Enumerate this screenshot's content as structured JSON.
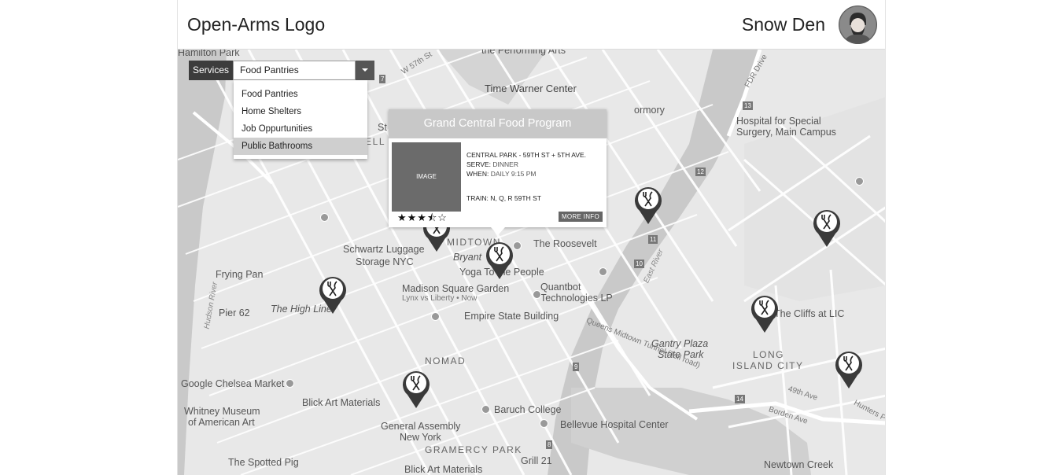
{
  "header": {
    "logo": "Open-Arms Logo",
    "username": "Snow Den"
  },
  "services": {
    "label": "Services",
    "selected": "Food Pantries",
    "options": [
      "Food Pantries",
      "Home Shelters",
      "Job Oppurtunities",
      "Public Bathrooms"
    ],
    "highlighted": "Public Bathrooms"
  },
  "popup": {
    "title": "Grand Central Food Program",
    "image_placeholder": "IMAGE",
    "location": "CENTRAL PARK - 59TH ST + 5TH AVE.",
    "serve_label": "SERVE:",
    "serve_value": "DINNER",
    "when_label": "WHEN:",
    "when_value": "DAILY 9:15 PM",
    "train": "TRAIN: N, Q, R 59TH ST",
    "rating": 3.5,
    "rating_max": 5,
    "stars": "★★★⯪☆",
    "more_info": "MORE INFO"
  },
  "map_labels": {
    "hamilton": "Hamilton Park",
    "perf_arts": "the Performing Arts",
    "time_warner": "Time Warner Center",
    "w57": "W 57th St",
    "hospital": "Hospital for Special",
    "hospital2": "Surgery, Main Campus",
    "fdr": "FDR Drive",
    "schwartz": "Schwartz Luggage",
    "schwartz2": "Storage NYC",
    "midtown": "MIDTOWN",
    "bryant": "Bryant",
    "roosevelt": "The Roosevelt",
    "yoga": "Yoga To the People",
    "quantbot": "Quantbot",
    "quantbot2": "Technologies LP",
    "msg": "Madison Square Garden",
    "lynx": "Lynx vs Liberty • Now",
    "frying": "Frying Pan",
    "highline": "The High Line",
    "pier": "Pier 62",
    "esb": "Empire State Building",
    "cliffs": "The Cliffs at LIC",
    "gantry": "Gantry Plaza",
    "gantry2": "State Park",
    "lic": "LONG",
    "lic2": "ISLAND CITY",
    "nomad": "NOMAD",
    "chelsea": "Google Chelsea Market",
    "whitney": "Whitney Museum",
    "whitney2": "of American Art",
    "blick": "Blick Art Materials",
    "baruch": "Baruch College",
    "bellevue": "Bellevue Hospital Center",
    "gen_assembly": "General Assembly",
    "gen_assembly2": "New York",
    "gramercy": "GRAMERCY PARK",
    "spotted": "The Spotted Pig",
    "grill": "Grill 21",
    "blick2": "Blick Art Materials",
    "newtown": "Newtown Creek",
    "hudson": "Hudson River",
    "east_river": "East River",
    "queens_tunnel": "Queens Midtown Tunnel (Toll road)",
    "hunters": "Hunters Po",
    "borden": "Borden Ave",
    "ave49": "49th Ave",
    "ormory": "ormory",
    "hell": "HELL",
    "st_frag": "St",
    "st_frag2": "St"
  },
  "colors": {
    "accent_dark": "#3c3c3c",
    "map_bg": "#e6e6e6",
    "water": "#c9c9c9",
    "park": "#d2d2d2"
  }
}
